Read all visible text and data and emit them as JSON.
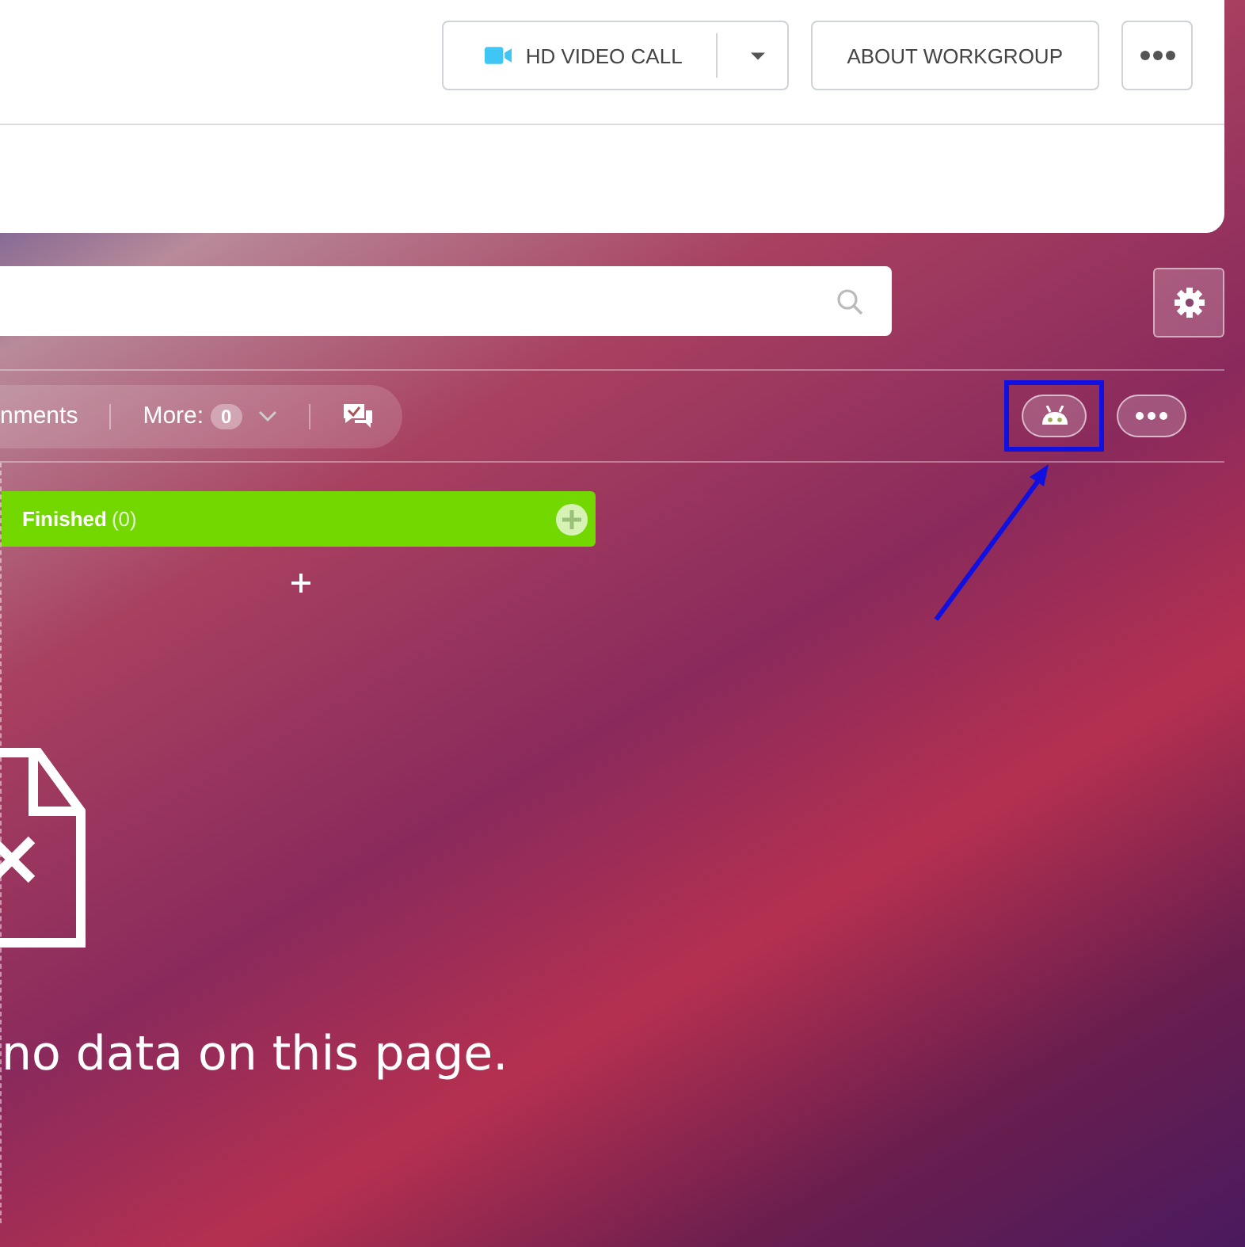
{
  "header": {
    "buttons": [
      {
        "kind": "video",
        "label": "HD VIDEO CALL"
      },
      {
        "kind": "text",
        "label": "ABOUT WORKGROUP"
      }
    ]
  },
  "toolbar": {
    "tab_partial": "nments",
    "more_label": "More:",
    "more_count": "0"
  },
  "columns": [
    {
      "title": "Finished",
      "count": "(0)",
      "color": "#72d800"
    }
  ],
  "empty_message": "no data on this page.",
  "annotation": {
    "highlight": true
  }
}
